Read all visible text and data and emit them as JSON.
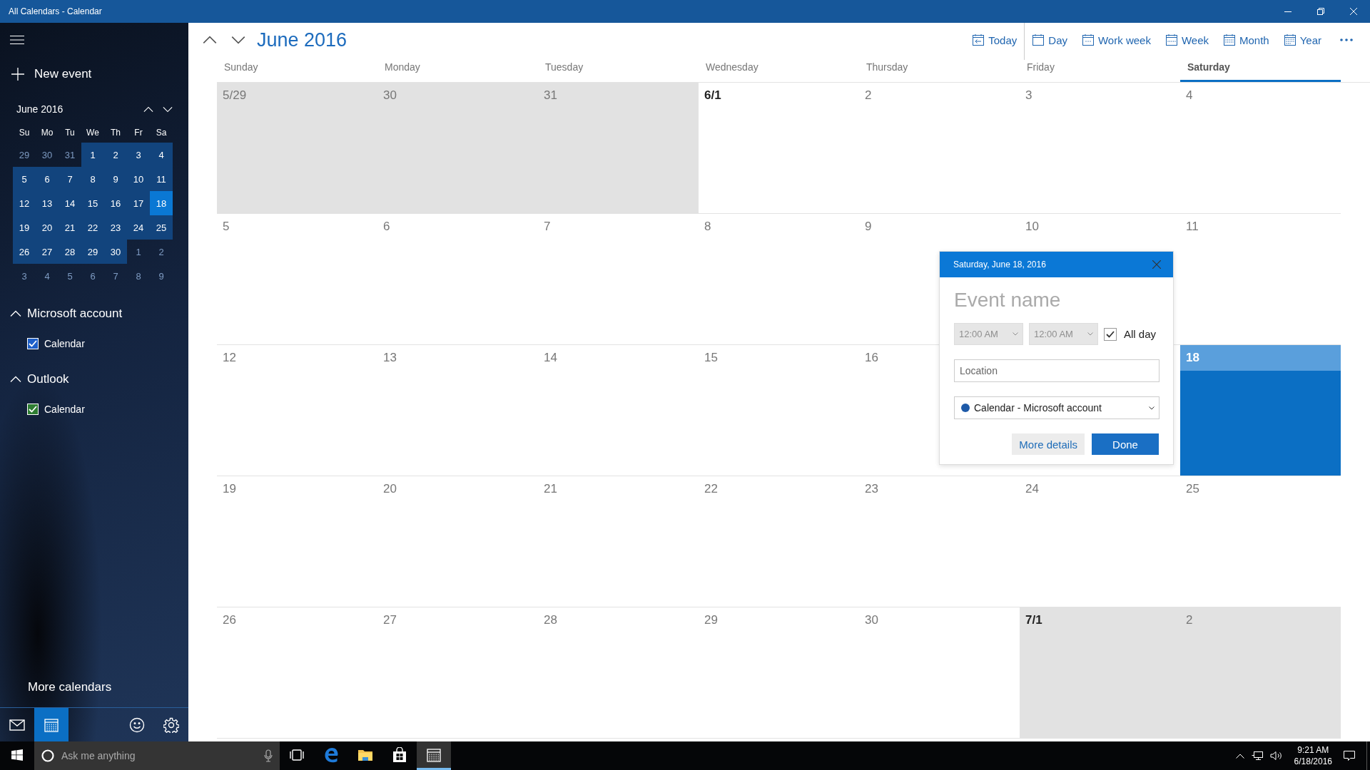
{
  "window": {
    "title": "All Calendars - Calendar"
  },
  "sidebar": {
    "new_event": "New event",
    "mini_calendar": {
      "title": "June 2016",
      "weekdays": [
        "Su",
        "Mo",
        "Tu",
        "We",
        "Th",
        "Fr",
        "Sa"
      ],
      "weeks": [
        [
          {
            "day": "29",
            "in_month": false,
            "selected": false
          },
          {
            "day": "30",
            "in_month": false,
            "selected": false
          },
          {
            "day": "31",
            "in_month": false,
            "selected": false
          },
          {
            "day": "1",
            "in_month": true,
            "selected": false
          },
          {
            "day": "2",
            "in_month": true,
            "selected": false
          },
          {
            "day": "3",
            "in_month": true,
            "selected": false
          },
          {
            "day": "4",
            "in_month": true,
            "selected": false
          }
        ],
        [
          {
            "day": "5",
            "in_month": true,
            "selected": false
          },
          {
            "day": "6",
            "in_month": true,
            "selected": false
          },
          {
            "day": "7",
            "in_month": true,
            "selected": false
          },
          {
            "day": "8",
            "in_month": true,
            "selected": false
          },
          {
            "day": "9",
            "in_month": true,
            "selected": false
          },
          {
            "day": "10",
            "in_month": true,
            "selected": false
          },
          {
            "day": "11",
            "in_month": true,
            "selected": false
          }
        ],
        [
          {
            "day": "12",
            "in_month": true,
            "selected": false
          },
          {
            "day": "13",
            "in_month": true,
            "selected": false
          },
          {
            "day": "14",
            "in_month": true,
            "selected": false
          },
          {
            "day": "15",
            "in_month": true,
            "selected": false
          },
          {
            "day": "16",
            "in_month": true,
            "selected": false
          },
          {
            "day": "17",
            "in_month": true,
            "selected": false
          },
          {
            "day": "18",
            "in_month": true,
            "selected": true
          }
        ],
        [
          {
            "day": "19",
            "in_month": true,
            "selected": false
          },
          {
            "day": "20",
            "in_month": true,
            "selected": false
          },
          {
            "day": "21",
            "in_month": true,
            "selected": false
          },
          {
            "day": "22",
            "in_month": true,
            "selected": false
          },
          {
            "day": "23",
            "in_month": true,
            "selected": false
          },
          {
            "day": "24",
            "in_month": true,
            "selected": false
          },
          {
            "day": "25",
            "in_month": true,
            "selected": false
          }
        ],
        [
          {
            "day": "26",
            "in_month": true,
            "selected": false
          },
          {
            "day": "27",
            "in_month": true,
            "selected": false
          },
          {
            "day": "28",
            "in_month": true,
            "selected": false
          },
          {
            "day": "29",
            "in_month": true,
            "selected": false
          },
          {
            "day": "30",
            "in_month": true,
            "selected": false
          },
          {
            "day": "1",
            "in_month": false,
            "selected": false
          },
          {
            "day": "2",
            "in_month": false,
            "selected": false
          }
        ],
        [
          {
            "day": "3",
            "in_month": false,
            "selected": false
          },
          {
            "day": "4",
            "in_month": false,
            "selected": false
          },
          {
            "day": "5",
            "in_month": false,
            "selected": false
          },
          {
            "day": "6",
            "in_month": false,
            "selected": false
          },
          {
            "day": "7",
            "in_month": false,
            "selected": false
          },
          {
            "day": "8",
            "in_month": false,
            "selected": false
          },
          {
            "day": "9",
            "in_month": false,
            "selected": false
          }
        ]
      ]
    },
    "groups": [
      {
        "name": "Microsoft account",
        "expanded": true,
        "calendars": [
          {
            "name": "Calendar",
            "checked": true,
            "color": "#1e5fc8"
          }
        ]
      },
      {
        "name": "Outlook",
        "expanded": true,
        "calendars": [
          {
            "name": "Calendar",
            "checked": true,
            "color": "#2e7d32"
          }
        ]
      }
    ],
    "more_calendars": "More calendars",
    "nav": [
      {
        "kind": "mail",
        "selected": false
      },
      {
        "kind": "calendar",
        "selected": true
      },
      {
        "kind": "feedback",
        "selected": false
      },
      {
        "kind": "settings",
        "selected": false
      }
    ]
  },
  "header": {
    "title": "June 2016",
    "views": [
      {
        "label": "Today",
        "kind": "today"
      },
      {
        "label": "Day",
        "kind": "day"
      },
      {
        "label": "Work week",
        "kind": "workweek"
      },
      {
        "label": "Week",
        "kind": "week"
      },
      {
        "label": "Month",
        "kind": "month"
      },
      {
        "label": "Year",
        "kind": "year"
      }
    ]
  },
  "weekdays": [
    {
      "label": "Sunday",
      "selected": false
    },
    {
      "label": "Monday",
      "selected": false
    },
    {
      "label": "Tuesday",
      "selected": false
    },
    {
      "label": "Wednesday",
      "selected": false
    },
    {
      "label": "Thursday",
      "selected": false
    },
    {
      "label": "Friday",
      "selected": false
    },
    {
      "label": "Saturday",
      "selected": true
    }
  ],
  "weeks": [
    [
      {
        "label": "5/29",
        "in_month": false,
        "month_start": false,
        "today": false
      },
      {
        "label": "30",
        "in_month": false,
        "month_start": false,
        "today": false
      },
      {
        "label": "31",
        "in_month": false,
        "month_start": false,
        "today": false
      },
      {
        "label": "6/1",
        "in_month": true,
        "month_start": true,
        "today": false
      },
      {
        "label": "2",
        "in_month": true,
        "month_start": false,
        "today": false
      },
      {
        "label": "3",
        "in_month": true,
        "month_start": false,
        "today": false
      },
      {
        "label": "4",
        "in_month": true,
        "month_start": false,
        "today": false
      }
    ],
    [
      {
        "label": "5",
        "in_month": true,
        "month_start": false,
        "today": false
      },
      {
        "label": "6",
        "in_month": true,
        "month_start": false,
        "today": false
      },
      {
        "label": "7",
        "in_month": true,
        "month_start": false,
        "today": false
      },
      {
        "label": "8",
        "in_month": true,
        "month_start": false,
        "today": false
      },
      {
        "label": "9",
        "in_month": true,
        "month_start": false,
        "today": false
      },
      {
        "label": "10",
        "in_month": true,
        "month_start": false,
        "today": false
      },
      {
        "label": "11",
        "in_month": true,
        "month_start": false,
        "today": false
      }
    ],
    [
      {
        "label": "12",
        "in_month": true,
        "month_start": false,
        "today": false
      },
      {
        "label": "13",
        "in_month": true,
        "month_start": false,
        "today": false
      },
      {
        "label": "14",
        "in_month": true,
        "month_start": false,
        "today": false
      },
      {
        "label": "15",
        "in_month": true,
        "month_start": false,
        "today": false
      },
      {
        "label": "16",
        "in_month": true,
        "month_start": false,
        "today": false
      },
      {
        "in_month": true,
        "today": false
      },
      {
        "label": "18",
        "in_month": true,
        "month_start": false,
        "today": true
      }
    ],
    [
      {
        "label": "19",
        "in_month": true,
        "month_start": false,
        "today": false
      },
      {
        "label": "20",
        "in_month": true,
        "month_start": false,
        "today": false
      },
      {
        "label": "21",
        "in_month": true,
        "month_start": false,
        "today": false
      },
      {
        "label": "22",
        "in_month": true,
        "month_start": false,
        "today": false
      },
      {
        "label": "23",
        "in_month": true,
        "month_start": false,
        "today": false
      },
      {
        "label": "24",
        "in_month": true,
        "month_start": false,
        "today": false
      },
      {
        "label": "25",
        "in_month": true,
        "month_start": false,
        "today": false
      }
    ],
    [
      {
        "label": "26",
        "in_month": true,
        "month_start": false,
        "today": false
      },
      {
        "label": "27",
        "in_month": true,
        "month_start": false,
        "today": false
      },
      {
        "label": "28",
        "in_month": true,
        "month_start": false,
        "today": false
      },
      {
        "label": "29",
        "in_month": true,
        "month_start": false,
        "today": false
      },
      {
        "label": "30",
        "in_month": true,
        "month_start": false,
        "today": false
      },
      {
        "label": "7/1",
        "in_month": false,
        "month_start": true,
        "today": false
      },
      {
        "label": "2",
        "in_month": false,
        "month_start": false,
        "today": false
      }
    ]
  ],
  "popup": {
    "date": "Saturday, June 18, 2016",
    "event_name": {
      "placeholder": "Event name"
    },
    "start_time": {
      "value": "12:00 AM",
      "disabled": true
    },
    "end_time": {
      "value": "12:00 AM",
      "disabled": true
    },
    "all_day": {
      "label": "All day",
      "checked": true
    },
    "location": {
      "placeholder": "Location"
    },
    "calendar": {
      "label": "Calendar - Microsoft account",
      "color": "#1e5aa8"
    },
    "buttons": [
      {
        "label": "More details",
        "kind": "secondary"
      },
      {
        "label": "Done",
        "kind": "primary"
      }
    ]
  },
  "taskbar": {
    "search": {
      "placeholder": "Ask me anything"
    },
    "apps": [
      {
        "kind": "taskview",
        "selected": false
      },
      {
        "kind": "edge",
        "selected": false
      },
      {
        "kind": "explorer",
        "selected": false
      },
      {
        "kind": "store",
        "selected": false
      },
      {
        "kind": "calendar",
        "selected": true
      }
    ],
    "time": "9:21 AM",
    "date": "6/18/2016"
  }
}
